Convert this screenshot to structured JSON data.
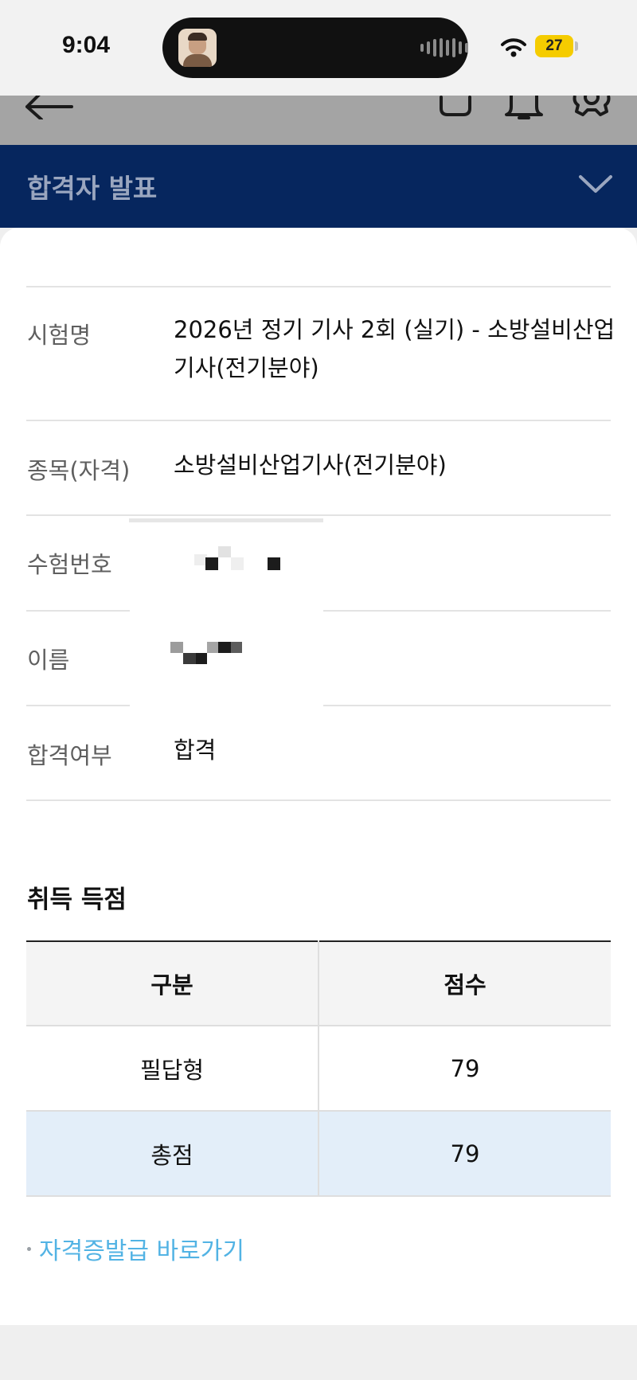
{
  "status_bar": {
    "time": "9:04",
    "battery": "27",
    "icons": [
      "wifi-icon",
      "battery-icon"
    ]
  },
  "header": {
    "icons": [
      "back-arrow-icon",
      "cart-icon",
      "bell-icon",
      "gear-icon"
    ]
  },
  "banner": {
    "title": "합격자 발표",
    "icon": "chevron-down-icon"
  },
  "result": {
    "rows": [
      {
        "label": "시험명",
        "value": "2026년 정기 기사 2회 (실기) - 소방설비산업기사(전기분야)"
      },
      {
        "label": "종목(자격)",
        "value": "소방설비산업기사(전기분야)"
      },
      {
        "label": "수험번호",
        "value": ""
      },
      {
        "label": "이름",
        "value": ""
      },
      {
        "label": "합격여부",
        "value": "합격"
      }
    ]
  },
  "scores": {
    "title": "취득 득점",
    "headers": [
      "구분",
      "점수"
    ],
    "rows": [
      {
        "category": "필답형",
        "score": "79"
      },
      {
        "category": "총점",
        "score": "79"
      }
    ]
  },
  "link": {
    "label": "자격증발급 바로가기"
  },
  "colors": {
    "banner": "#06265e",
    "link": "#52b3e4",
    "total_row": "#e3eef9",
    "battery": "#f5cc00"
  }
}
